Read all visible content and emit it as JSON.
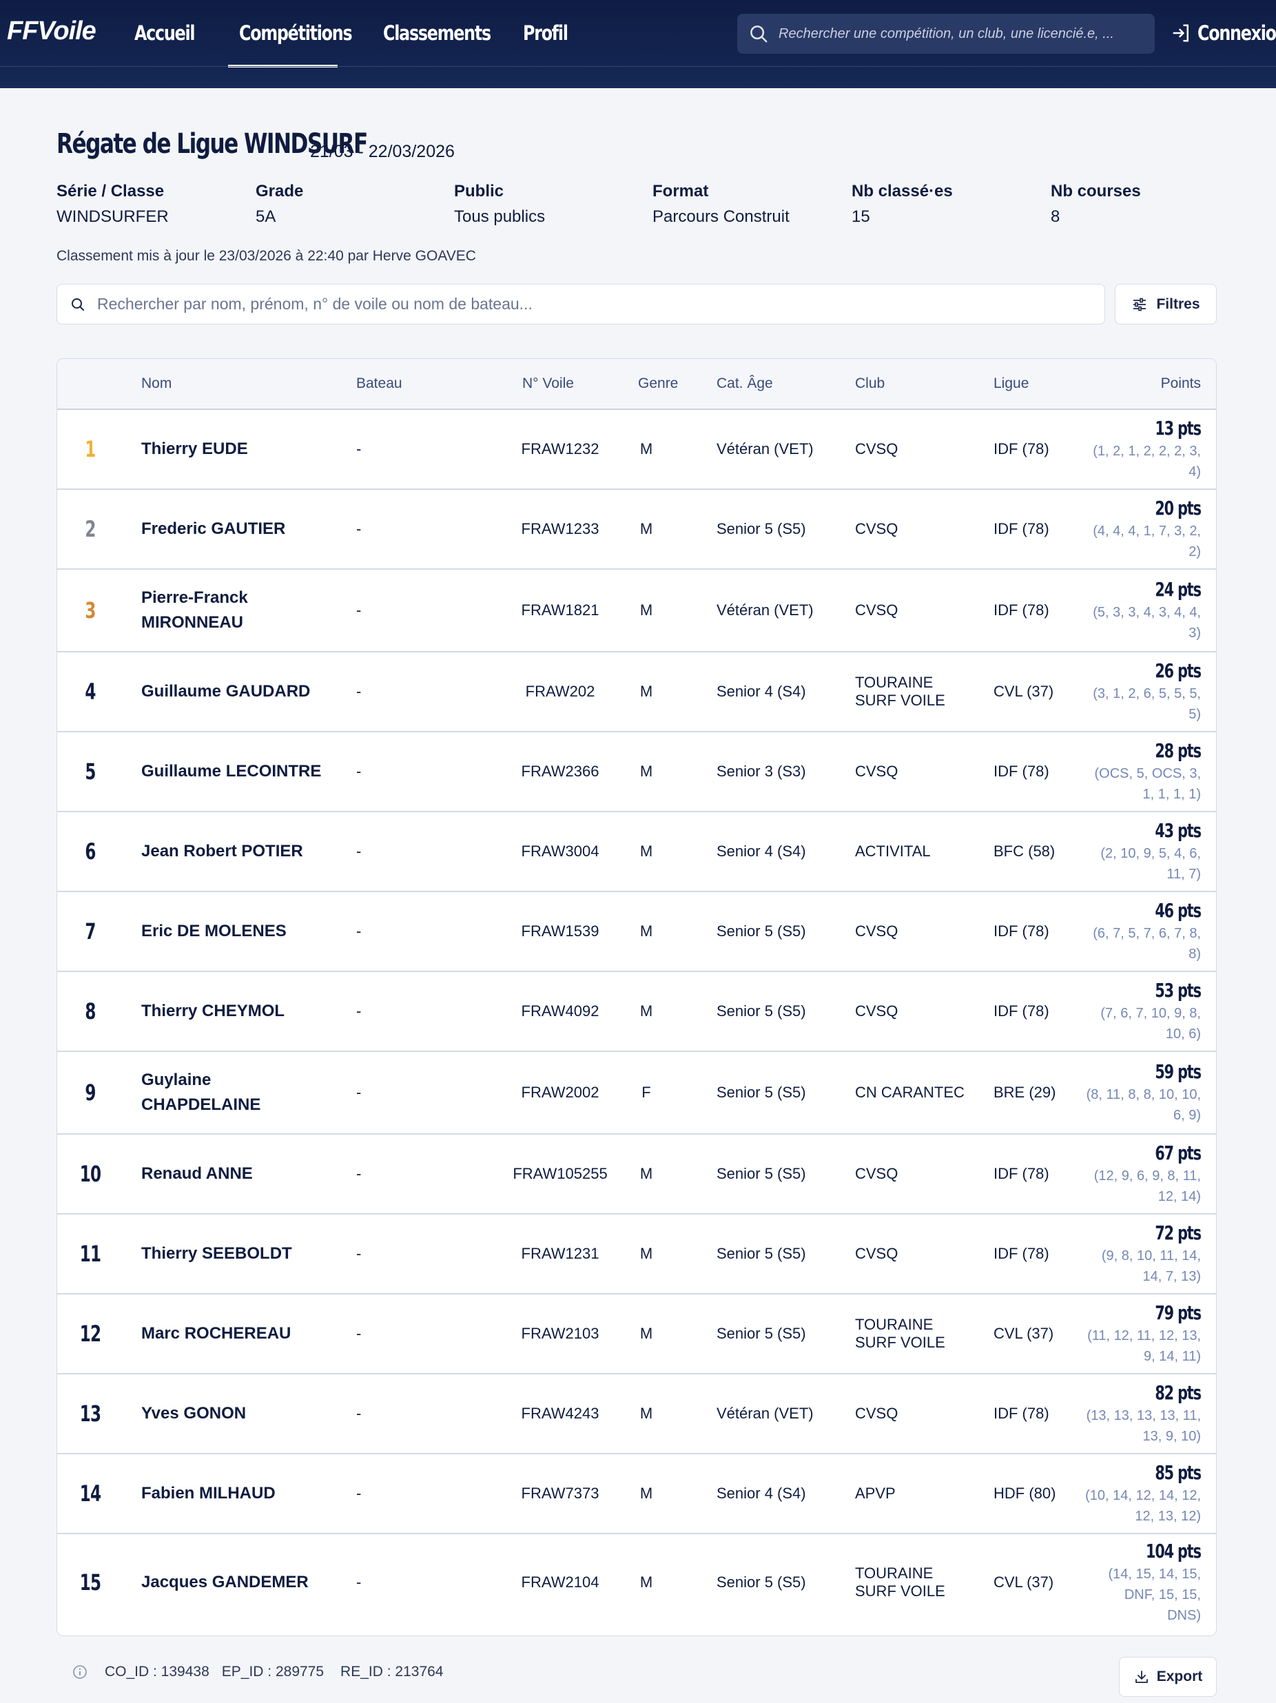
{
  "header": {
    "logo": "FFVoile",
    "nav": [
      "Accueil",
      "Compétitions",
      "Classements",
      "Profil"
    ],
    "active_nav": "Compétitions",
    "search_placeholder": "Rechercher une compétition, un club, une licencié.e, ...",
    "login": "Connexion"
  },
  "competition": {
    "title": "Régate de Ligue WINDSURF",
    "dates": "21/03 - 22/03/2026",
    "meta": [
      {
        "label": "Série / Classe",
        "value": "WINDSURFER"
      },
      {
        "label": "Grade",
        "value": "5A"
      },
      {
        "label": "Public",
        "value": "Tous publics"
      },
      {
        "label": "Format",
        "value": "Parcours Construit"
      },
      {
        "label": "Nb classé·es",
        "value": "15"
      },
      {
        "label": "Nb courses",
        "value": "8"
      }
    ],
    "updated": "Classement mis à jour le 23/03/2026 à 22:40 par Herve GOAVEC"
  },
  "search": {
    "placeholder": "Rechercher par nom, prénom, n° de voile ou nom de bateau...",
    "filters_label": "Filtres"
  },
  "table": {
    "headers": [
      "Nom",
      "Bateau",
      "N° Voile",
      "Genre",
      "Cat. Âge",
      "Club",
      "Ligue",
      "Points"
    ],
    "rows": [
      {
        "rank": "1",
        "name": "Thierry EUDE",
        "bateau": "-",
        "voile": "FRAW1232",
        "genre": "M",
        "cat": "Vétéran (VET)",
        "club": "CVSQ",
        "ligue": "IDF (78)",
        "points": "13 pts",
        "detail": "(1, 2, 1, 2, 2, 2, 3,\n4)"
      },
      {
        "rank": "2",
        "name": "Frederic GAUTIER",
        "bateau": "-",
        "voile": "FRAW1233",
        "genre": "M",
        "cat": "Senior 5 (S5)",
        "club": "CVSQ",
        "ligue": "IDF (78)",
        "points": "20 pts",
        "detail": "(4, 4, 4, 1, 7, 3, 2,\n2)"
      },
      {
        "rank": "3",
        "name": "Pierre-Franck\nMIRONNEAU",
        "bateau": "-",
        "voile": "FRAW1821",
        "genre": "M",
        "cat": "Vétéran (VET)",
        "club": "CVSQ",
        "ligue": "IDF (78)",
        "points": "24 pts",
        "detail": "(5, 3, 3, 4, 3, 4, 4,\n3)"
      },
      {
        "rank": "4",
        "name": "Guillaume GAUDARD",
        "bateau": "-",
        "voile": "FRAW202",
        "genre": "M",
        "cat": "Senior 4 (S4)",
        "club": "TOURAINE\nSURF VOILE",
        "ligue": "CVL (37)",
        "points": "26 pts",
        "detail": "(3, 1, 2, 6, 5, 5, 5,\n5)"
      },
      {
        "rank": "5",
        "name": "Guillaume LECOINTRE",
        "bateau": "-",
        "voile": "FRAW2366",
        "genre": "M",
        "cat": "Senior 3 (S3)",
        "club": "CVSQ",
        "ligue": "IDF (78)",
        "points": "28 pts",
        "detail": "(OCS, 5, OCS, 3,\n1, 1, 1, 1)"
      },
      {
        "rank": "6",
        "name": "Jean Robert POTIER",
        "bateau": "-",
        "voile": "FRAW3004",
        "genre": "M",
        "cat": "Senior 4 (S4)",
        "club": "ACTIVITAL",
        "ligue": "BFC (58)",
        "points": "43 pts",
        "detail": "(2, 10, 9, 5, 4, 6,\n11, 7)"
      },
      {
        "rank": "7",
        "name": "Eric DE MOLENES",
        "bateau": "-",
        "voile": "FRAW1539",
        "genre": "M",
        "cat": "Senior 5 (S5)",
        "club": "CVSQ",
        "ligue": "IDF (78)",
        "points": "46 pts",
        "detail": "(6, 7, 5, 7, 6, 7, 8,\n8)"
      },
      {
        "rank": "8",
        "name": "Thierry CHEYMOL",
        "bateau": "-",
        "voile": "FRAW4092",
        "genre": "M",
        "cat": "Senior 5 (S5)",
        "club": "CVSQ",
        "ligue": "IDF (78)",
        "points": "53 pts",
        "detail": "(7, 6, 7, 10, 9, 8,\n10, 6)"
      },
      {
        "rank": "9",
        "name": "Guylaine\nCHAPDELAINE",
        "bateau": "-",
        "voile": "FRAW2002",
        "genre": "F",
        "cat": "Senior 5 (S5)",
        "club": "CN CARANTEC",
        "ligue": "BRE (29)",
        "points": "59 pts",
        "detail": "(8, 11, 8, 8, 10, 10,\n6, 9)"
      },
      {
        "rank": "10",
        "name": "Renaud ANNE",
        "bateau": "-",
        "voile": "FRAW105255",
        "genre": "M",
        "cat": "Senior 5 (S5)",
        "club": "CVSQ",
        "ligue": "IDF (78)",
        "points": "67 pts",
        "detail": "(12, 9, 6, 9, 8, 11,\n12, 14)"
      },
      {
        "rank": "11",
        "name": "Thierry SEEBOLDT",
        "bateau": "-",
        "voile": "FRAW1231",
        "genre": "M",
        "cat": "Senior 5 (S5)",
        "club": "CVSQ",
        "ligue": "IDF (78)",
        "points": "72 pts",
        "detail": "(9, 8, 10, 11, 14,\n14, 7, 13)"
      },
      {
        "rank": "12",
        "name": "Marc ROCHEREAU",
        "bateau": "-",
        "voile": "FRAW2103",
        "genre": "M",
        "cat": "Senior 5 (S5)",
        "club": "TOURAINE\nSURF VOILE",
        "ligue": "CVL (37)",
        "points": "79 pts",
        "detail": "(11, 12, 11, 12, 13,\n9, 14, 11)"
      },
      {
        "rank": "13",
        "name": "Yves GONON",
        "bateau": "-",
        "voile": "FRAW4243",
        "genre": "M",
        "cat": "Vétéran (VET)",
        "club": "CVSQ",
        "ligue": "IDF (78)",
        "points": "82 pts",
        "detail": "(13, 13, 13, 13, 11,\n13, 9, 10)"
      },
      {
        "rank": "14",
        "name": "Fabien MILHAUD",
        "bateau": "-",
        "voile": "FRAW7373",
        "genre": "M",
        "cat": "Senior 4 (S4)",
        "club": "APVP",
        "ligue": "HDF (80)",
        "points": "85 pts",
        "detail": "(10, 14, 12, 14, 12,\n12, 13, 12)"
      },
      {
        "rank": "15",
        "name": "Jacques GANDEMER",
        "bateau": "-",
        "voile": "FRAW2104",
        "genre": "M",
        "cat": "Senior 5 (S5)",
        "club": "TOURAINE\nSURF VOILE",
        "ligue": "CVL (37)",
        "points": "104 pts",
        "detail": "(14, 15, 14, 15,\nDNF, 15, 15,\nDNS)"
      }
    ]
  },
  "footer": {
    "co_id": "CO_ID : 139438",
    "ep_id": "EP_ID : 289775",
    "re_id": "RE_ID : 213764",
    "export_label": "Export"
  },
  "colors": {
    "header_bg": "#0f1d45",
    "gold": "#f0b13a",
    "silver": "#7f8593",
    "bronze": "#d08a31",
    "detail_blue": "#7587b5"
  }
}
